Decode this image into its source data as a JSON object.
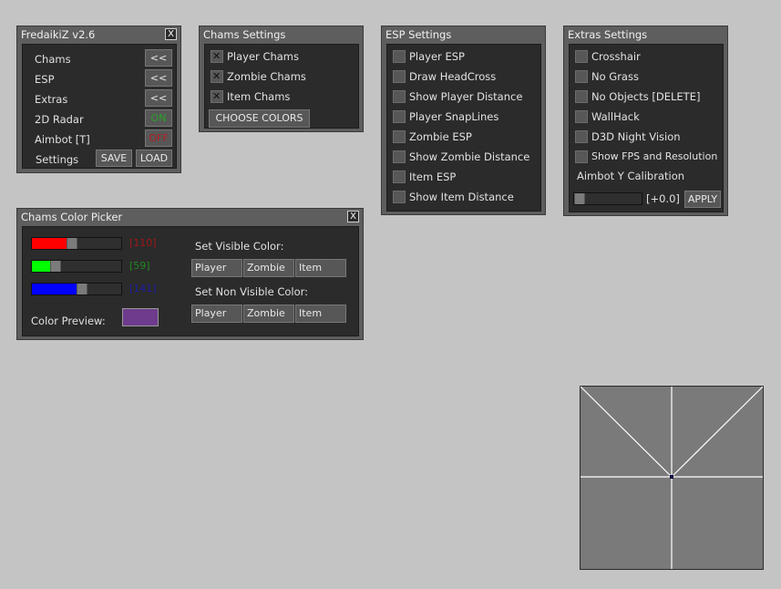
{
  "main_panel": {
    "title": "FredaikiZ v2.6",
    "close": "X",
    "rows": [
      {
        "label": "Chams",
        "button": "<<"
      },
      {
        "label": "ESP",
        "button": "<<"
      },
      {
        "label": "Extras",
        "button": "<<"
      },
      {
        "label": "2D Radar",
        "button": "ON",
        "color": "#26a326"
      },
      {
        "label": "Aimbot [T]",
        "button": "OFF",
        "color": "#b02020"
      }
    ],
    "settings_label": "Settings",
    "save_label": "SAVE",
    "load_label": "LOAD"
  },
  "chams_settings": {
    "title": "Chams Settings",
    "items": [
      {
        "label": "Player Chams",
        "checked": true
      },
      {
        "label": "Zombie Chams",
        "checked": true
      },
      {
        "label": "Item Chams",
        "checked": true
      }
    ],
    "choose_colors": "CHOOSE COLORS"
  },
  "esp_settings": {
    "title": "ESP Settings",
    "items": [
      {
        "label": "Player ESP",
        "checked": false
      },
      {
        "label": "Draw HeadCross",
        "checked": false
      },
      {
        "label": "Show Player Distance",
        "checked": false
      },
      {
        "label": "Player SnapLines",
        "checked": false
      },
      {
        "label": "Zombie ESP",
        "checked": false
      },
      {
        "label": "Show Zombie Distance",
        "checked": false
      },
      {
        "label": "Item ESP",
        "checked": false
      },
      {
        "label": "Show Item Distance",
        "checked": false
      }
    ]
  },
  "extras_settings": {
    "title": "Extras Settings",
    "items": [
      {
        "label": "Crosshair",
        "checked": false
      },
      {
        "label": "No Grass",
        "checked": false
      },
      {
        "label": "No Objects [DELETE]",
        "checked": false
      },
      {
        "label": "WallHack",
        "checked": false
      },
      {
        "label": "D3D Night Vision",
        "checked": false
      },
      {
        "label": "Show FPS and Resolution",
        "checked": false
      }
    ],
    "aimbot_calibration_label": "Aimbot Y Calibration",
    "calibration_value": "[+0.0]",
    "apply_label": "APPLY"
  },
  "color_picker": {
    "title": "Chams Color Picker",
    "close": "X",
    "sliders": [
      {
        "name": "red",
        "value": 110,
        "display": "[110]",
        "color": "#ff0000",
        "text_color": "#a41515"
      },
      {
        "name": "green",
        "value": 59,
        "display": "[59]",
        "color": "#00ff00",
        "text_color": "#1f8a1f"
      },
      {
        "name": "blue",
        "value": 141,
        "display": "[141]",
        "color": "#0000ff",
        "text_color": "#1a1aa8"
      }
    ],
    "preview_label": "Color Preview:",
    "preview_color": "#6e3b8d",
    "visible_label": "Set Visible Color:",
    "non_visible_label": "Set Non Visible Color:",
    "visible_buttons": [
      "Player",
      "Zombie",
      "Item"
    ],
    "non_visible_buttons": [
      "Player",
      "Zombie",
      "Item"
    ]
  },
  "radar": {
    "background": "#7a7a7a",
    "line_color": "#ffffff",
    "center_color": "#0a0a40"
  }
}
